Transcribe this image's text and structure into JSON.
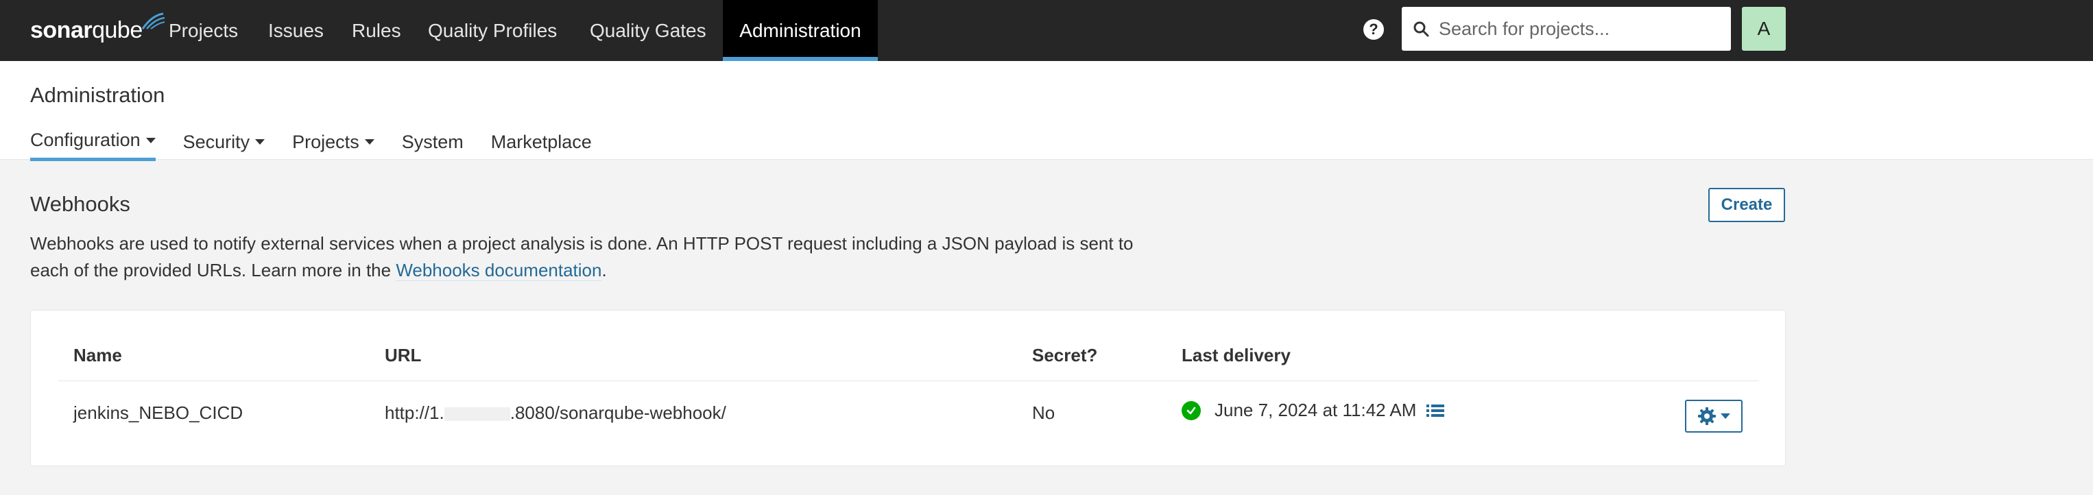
{
  "topbar": {
    "logo_text_a": "sonar",
    "logo_text_b": "qube",
    "nav": [
      "Projects",
      "Issues",
      "Rules",
      "Quality Profiles",
      "Quality Gates",
      "Administration"
    ],
    "active_nav": "Administration",
    "search_placeholder": "Search for projects...",
    "help_label": "?",
    "avatar_letter": "A"
  },
  "page": {
    "title": "Administration",
    "subnav": [
      "Configuration",
      "Security",
      "Projects",
      "System",
      "Marketplace"
    ],
    "active_subnav": "Configuration"
  },
  "webhooks": {
    "title": "Webhooks",
    "create_label": "Create",
    "description": "Webhooks are used to notify external services when a project analysis is done. An HTTP POST request including a JSON payload is sent to each of the provided URLs. Learn more in the ",
    "doc_link": "Webhooks documentation",
    "description_end": ".",
    "columns": [
      "Name",
      "URL",
      "Secret?",
      "Last delivery"
    ],
    "rows": [
      {
        "name": "jenkins_NEBO_CICD",
        "url": "http://1.",
        "url_tail": ".8080/sonarqube-webhook/",
        "secret": "No",
        "last_delivery": "June 7, 2024 at 11:42 AM",
        "status_color": "#00aa00"
      }
    ]
  },
  "colors": {
    "topbar_bg": "#262626",
    "accent": "#4b9fd5",
    "link": "#236a97",
    "avatar_bg": "#b8e6c1"
  }
}
